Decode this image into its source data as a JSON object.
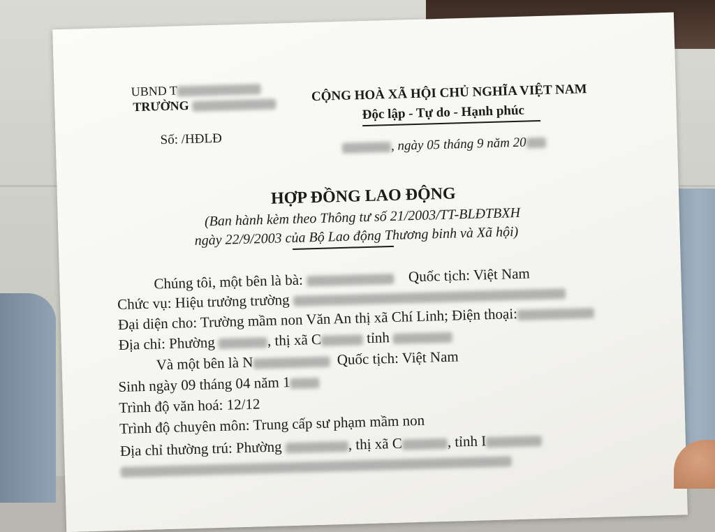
{
  "header_left": {
    "line1": "UBND T",
    "line2": "TRƯỜNG",
    "number": "Số:      /HĐLĐ"
  },
  "header_right": {
    "country": "CỘNG HOÀ XÃ HỘI CHỦ  NGHĨA VIỆT NAM",
    "motto": "Độc lập - Tự do - Hạnh phúc",
    "date": ", ngày 05 tháng 9  năm 20"
  },
  "title": "HỢP ĐỒNG LAO ĐỘNG",
  "subtitle1": "(Ban hành kèm theo Thông tư số 21/2003/TT-BLĐTBXH",
  "subtitle2": "ngày 22/9/2003 của Bộ Lao động Thương binh và Xã hội)",
  "body": {
    "l1a": "Chúng tôi, một bên là bà:",
    "l1b": "Quốc tịch: Việt Nam",
    "l2": "Chức vụ: Hiệu trưởng trường",
    "l3": "Đại diện cho: Trường mầm non Văn An  thị xã Chí Linh; Điện thoại:",
    "l4a": "Địa chỉ: Phường",
    "l4b": ", thị xã C",
    "l4c": "tỉnh",
    "l5a": "Và một bên là  N",
    "l5b": "Quốc tịch: Việt Nam",
    "l6": "Sinh ngày 09 tháng 04 năm 1",
    "l7": "Trình độ văn hoá: 12/12",
    "l8": "Trình độ chuyên môn: Trung cấp sư phạm mầm non",
    "l9a": "Địa chỉ thường trú: Phường",
    "l9b": ", thị xã C",
    "l9c": ", tỉnh I"
  }
}
